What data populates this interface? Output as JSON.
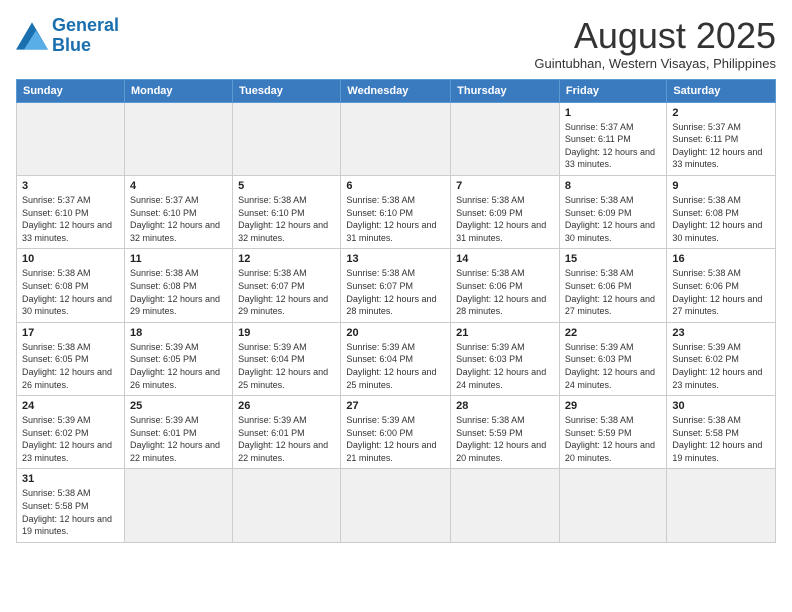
{
  "logo": {
    "text_general": "General",
    "text_blue": "Blue"
  },
  "calendar": {
    "title": "August 2025",
    "subtitle": "Guintubhan, Western Visayas, Philippines"
  },
  "headers": [
    "Sunday",
    "Monday",
    "Tuesday",
    "Wednesday",
    "Thursday",
    "Friday",
    "Saturday"
  ],
  "weeks": [
    [
      {
        "num": "",
        "info": "",
        "empty": true
      },
      {
        "num": "",
        "info": "",
        "empty": true
      },
      {
        "num": "",
        "info": "",
        "empty": true
      },
      {
        "num": "",
        "info": "",
        "empty": true
      },
      {
        "num": "",
        "info": "",
        "empty": true
      },
      {
        "num": "1",
        "info": "Sunrise: 5:37 AM\nSunset: 6:11 PM\nDaylight: 12 hours\nand 33 minutes.",
        "empty": false
      },
      {
        "num": "2",
        "info": "Sunrise: 5:37 AM\nSunset: 6:11 PM\nDaylight: 12 hours\nand 33 minutes.",
        "empty": false
      }
    ],
    [
      {
        "num": "3",
        "info": "Sunrise: 5:37 AM\nSunset: 6:10 PM\nDaylight: 12 hours\nand 33 minutes.",
        "empty": false
      },
      {
        "num": "4",
        "info": "Sunrise: 5:37 AM\nSunset: 6:10 PM\nDaylight: 12 hours\nand 32 minutes.",
        "empty": false
      },
      {
        "num": "5",
        "info": "Sunrise: 5:38 AM\nSunset: 6:10 PM\nDaylight: 12 hours\nand 32 minutes.",
        "empty": false
      },
      {
        "num": "6",
        "info": "Sunrise: 5:38 AM\nSunset: 6:10 PM\nDaylight: 12 hours\nand 31 minutes.",
        "empty": false
      },
      {
        "num": "7",
        "info": "Sunrise: 5:38 AM\nSunset: 6:09 PM\nDaylight: 12 hours\nand 31 minutes.",
        "empty": false
      },
      {
        "num": "8",
        "info": "Sunrise: 5:38 AM\nSunset: 6:09 PM\nDaylight: 12 hours\nand 30 minutes.",
        "empty": false
      },
      {
        "num": "9",
        "info": "Sunrise: 5:38 AM\nSunset: 6:08 PM\nDaylight: 12 hours\nand 30 minutes.",
        "empty": false
      }
    ],
    [
      {
        "num": "10",
        "info": "Sunrise: 5:38 AM\nSunset: 6:08 PM\nDaylight: 12 hours\nand 30 minutes.",
        "empty": false
      },
      {
        "num": "11",
        "info": "Sunrise: 5:38 AM\nSunset: 6:08 PM\nDaylight: 12 hours\nand 29 minutes.",
        "empty": false
      },
      {
        "num": "12",
        "info": "Sunrise: 5:38 AM\nSunset: 6:07 PM\nDaylight: 12 hours\nand 29 minutes.",
        "empty": false
      },
      {
        "num": "13",
        "info": "Sunrise: 5:38 AM\nSunset: 6:07 PM\nDaylight: 12 hours\nand 28 minutes.",
        "empty": false
      },
      {
        "num": "14",
        "info": "Sunrise: 5:38 AM\nSunset: 6:06 PM\nDaylight: 12 hours\nand 28 minutes.",
        "empty": false
      },
      {
        "num": "15",
        "info": "Sunrise: 5:38 AM\nSunset: 6:06 PM\nDaylight: 12 hours\nand 27 minutes.",
        "empty": false
      },
      {
        "num": "16",
        "info": "Sunrise: 5:38 AM\nSunset: 6:06 PM\nDaylight: 12 hours\nand 27 minutes.",
        "empty": false
      }
    ],
    [
      {
        "num": "17",
        "info": "Sunrise: 5:38 AM\nSunset: 6:05 PM\nDaylight: 12 hours\nand 26 minutes.",
        "empty": false
      },
      {
        "num": "18",
        "info": "Sunrise: 5:39 AM\nSunset: 6:05 PM\nDaylight: 12 hours\nand 26 minutes.",
        "empty": false
      },
      {
        "num": "19",
        "info": "Sunrise: 5:39 AM\nSunset: 6:04 PM\nDaylight: 12 hours\nand 25 minutes.",
        "empty": false
      },
      {
        "num": "20",
        "info": "Sunrise: 5:39 AM\nSunset: 6:04 PM\nDaylight: 12 hours\nand 25 minutes.",
        "empty": false
      },
      {
        "num": "21",
        "info": "Sunrise: 5:39 AM\nSunset: 6:03 PM\nDaylight: 12 hours\nand 24 minutes.",
        "empty": false
      },
      {
        "num": "22",
        "info": "Sunrise: 5:39 AM\nSunset: 6:03 PM\nDaylight: 12 hours\nand 24 minutes.",
        "empty": false
      },
      {
        "num": "23",
        "info": "Sunrise: 5:39 AM\nSunset: 6:02 PM\nDaylight: 12 hours\nand 23 minutes.",
        "empty": false
      }
    ],
    [
      {
        "num": "24",
        "info": "Sunrise: 5:39 AM\nSunset: 6:02 PM\nDaylight: 12 hours\nand 23 minutes.",
        "empty": false
      },
      {
        "num": "25",
        "info": "Sunrise: 5:39 AM\nSunset: 6:01 PM\nDaylight: 12 hours\nand 22 minutes.",
        "empty": false
      },
      {
        "num": "26",
        "info": "Sunrise: 5:39 AM\nSunset: 6:01 PM\nDaylight: 12 hours\nand 22 minutes.",
        "empty": false
      },
      {
        "num": "27",
        "info": "Sunrise: 5:39 AM\nSunset: 6:00 PM\nDaylight: 12 hours\nand 21 minutes.",
        "empty": false
      },
      {
        "num": "28",
        "info": "Sunrise: 5:38 AM\nSunset: 5:59 PM\nDaylight: 12 hours\nand 20 minutes.",
        "empty": false
      },
      {
        "num": "29",
        "info": "Sunrise: 5:38 AM\nSunset: 5:59 PM\nDaylight: 12 hours\nand 20 minutes.",
        "empty": false
      },
      {
        "num": "30",
        "info": "Sunrise: 5:38 AM\nSunset: 5:58 PM\nDaylight: 12 hours\nand 19 minutes.",
        "empty": false
      }
    ],
    [
      {
        "num": "31",
        "info": "Sunrise: 5:38 AM\nSunset: 5:58 PM\nDaylight: 12 hours\nand 19 minutes.",
        "empty": false
      },
      {
        "num": "",
        "info": "",
        "empty": true
      },
      {
        "num": "",
        "info": "",
        "empty": true
      },
      {
        "num": "",
        "info": "",
        "empty": true
      },
      {
        "num": "",
        "info": "",
        "empty": true
      },
      {
        "num": "",
        "info": "",
        "empty": true
      },
      {
        "num": "",
        "info": "",
        "empty": true
      }
    ]
  ]
}
